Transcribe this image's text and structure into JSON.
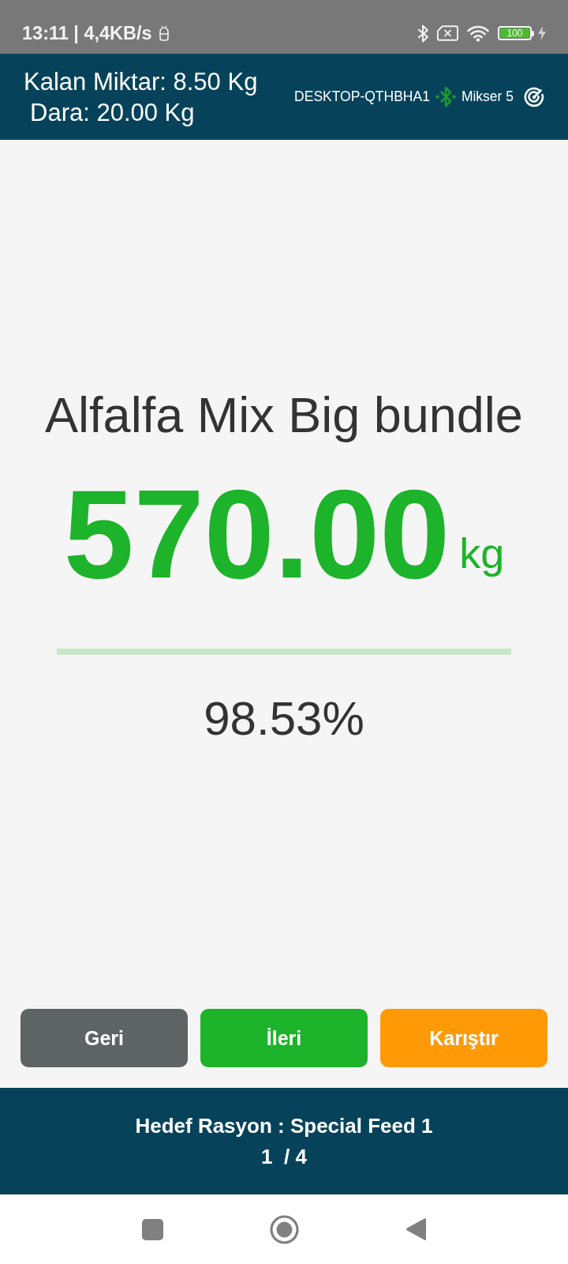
{
  "status_bar": {
    "text": "13:11 | 4,4KB/s",
    "battery": "100"
  },
  "header": {
    "remaining": "Kalan Miktar: 8.50 Kg",
    "tare": "Dara: 20.00 Kg",
    "device": "DESKTOP-QTHBHA1",
    "mixer": "Mikser 5"
  },
  "scale": {
    "ingredient": "Alfalfa Mix Big bundle",
    "weight": "570.00",
    "unit": "kg",
    "progress": {
      "level": 1
    },
    "percent": "98.53%"
  },
  "buttons": [
    {
      "label": "Geri",
      "kind": "back"
    },
    {
      "label": "İleri",
      "kind": "next"
    },
    {
      "label": "Karıştır",
      "kind": "mix"
    }
  ],
  "footer": {
    "ration": "Hedef Rasyon : Special Feed 1",
    "page": "1  / 4"
  }
}
